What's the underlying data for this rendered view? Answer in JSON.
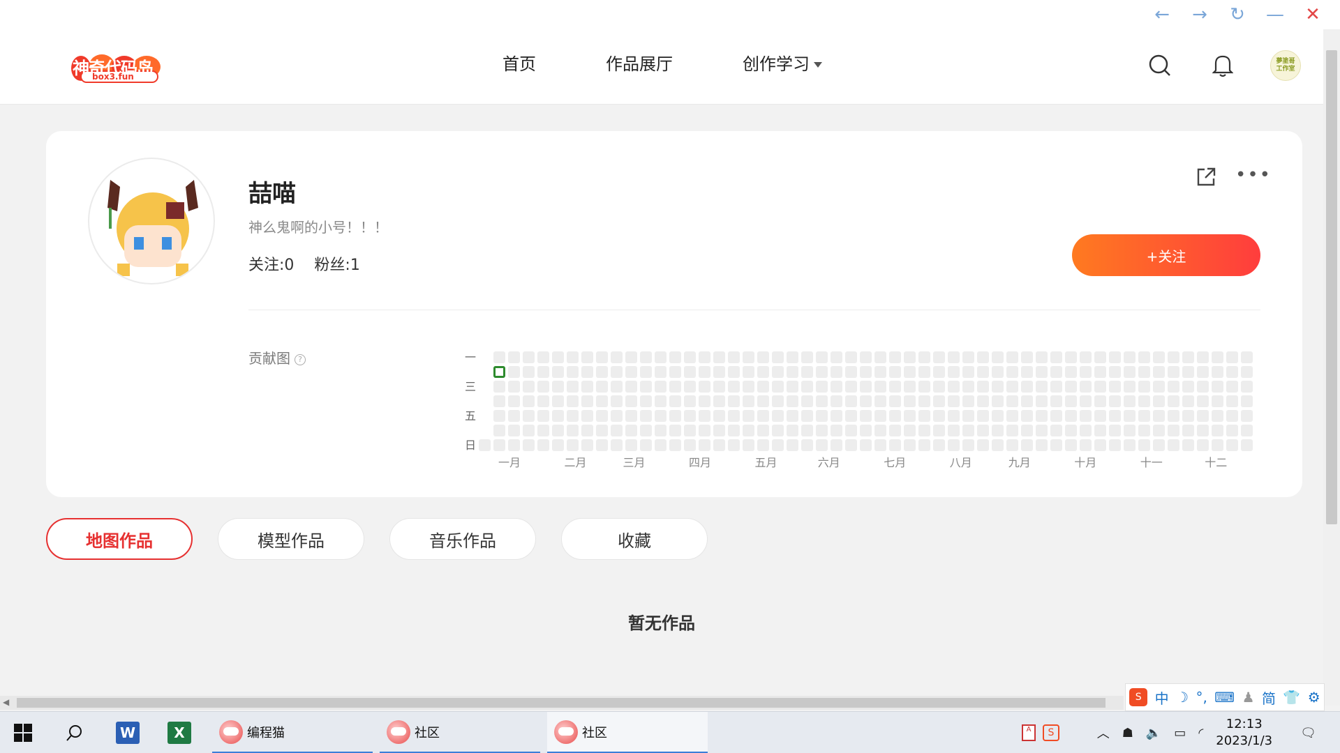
{
  "nav": {
    "logo_text": "神奇代码岛",
    "logo_sub": "box3.fun",
    "links": [
      "首页",
      "作品展厅",
      "创作学习"
    ],
    "avatar_text": "夢塗哥\n工作室"
  },
  "profile": {
    "name": "喆喵",
    "signature": "神么鬼啊的小号！！！",
    "following": "关注:0",
    "followers": "粉丝:1",
    "follow_button": "+关注"
  },
  "contribution": {
    "label": "贡献图",
    "help": "?",
    "day_labels": [
      "一",
      "三",
      "五",
      "日"
    ],
    "months": [
      "一月",
      "二月",
      "三月",
      "四月",
      "五月",
      "六月",
      "七月",
      "八月",
      "九月",
      "十月",
      "十一",
      "十二"
    ],
    "weeks": 53,
    "active_cells": [
      [
        1,
        1
      ]
    ]
  },
  "tabs": [
    {
      "label": "地图作品",
      "active": true
    },
    {
      "label": "模型作品",
      "active": false
    },
    {
      "label": "音乐作品",
      "active": false
    },
    {
      "label": "收藏",
      "active": false
    }
  ],
  "empty_text": "暂无作品",
  "ime": {
    "sogou": "S",
    "lang": "中",
    "mode": "简"
  },
  "taskbar": {
    "apps": [
      "编程猫",
      "社区",
      "社区"
    ],
    "time": "12:13",
    "date": "2023/1/3"
  },
  "colors": {
    "accent": "#e63030",
    "follow_start": "#ff7a20",
    "follow_end": "#ff3d3d",
    "contrib_active": "#2e8b2e"
  }
}
